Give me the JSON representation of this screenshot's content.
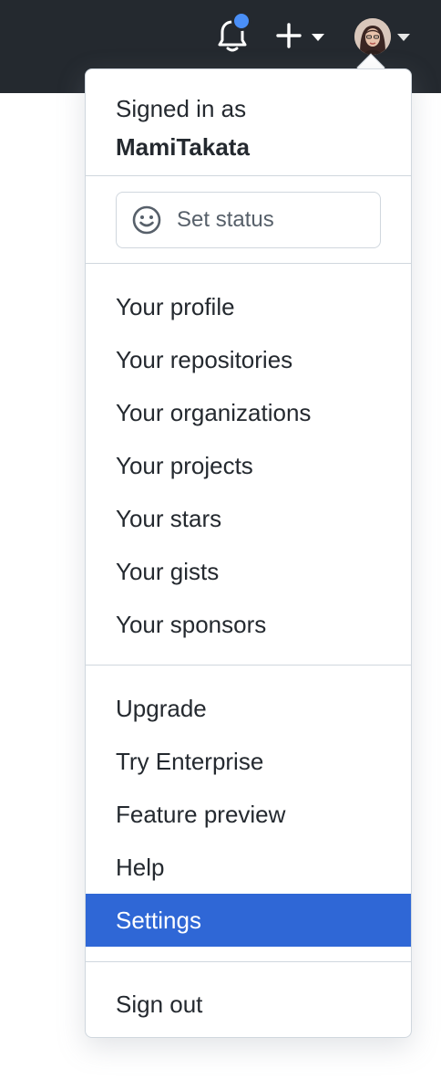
{
  "topbar": {
    "icons": [
      "bell-icon",
      "plus-icon",
      "chevron-down-icon",
      "avatar",
      "chevron-down-icon"
    ],
    "notification_color": "#4a8ff7",
    "background": "#24292f"
  },
  "dropdown": {
    "signed_in_label": "Signed in as",
    "username": "MamiTakata",
    "set_status_label": "Set status",
    "sections": [
      [
        "Your profile",
        "Your repositories",
        "Your organizations",
        "Your projects",
        "Your stars",
        "Your gists",
        "Your sponsors"
      ],
      [
        "Upgrade",
        "Try Enterprise",
        "Feature preview",
        "Help",
        "Settings"
      ],
      [
        "Sign out"
      ]
    ],
    "active_item": "Settings",
    "accent_color": "#2f67d6"
  }
}
